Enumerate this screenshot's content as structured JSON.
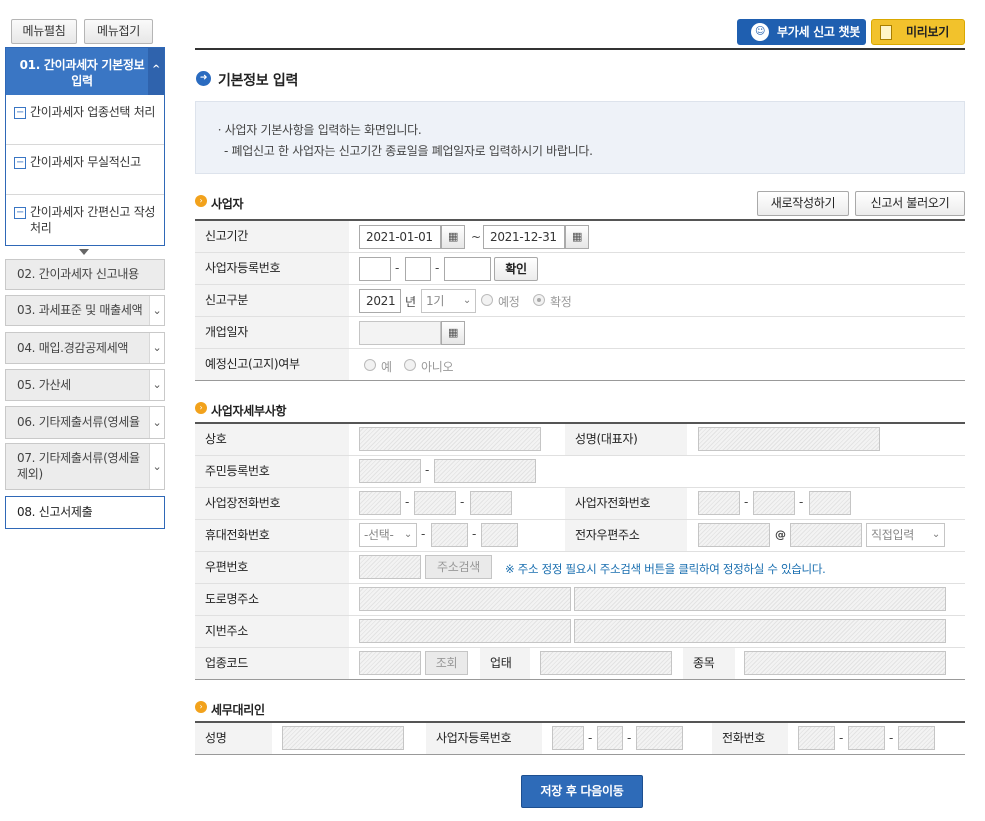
{
  "toolbar": {
    "expand": "메뉴펼침",
    "collapse": "메뉴접기",
    "chatbot": "부가세 신고 챗봇",
    "preview": "미리보기"
  },
  "sidebar": {
    "active": {
      "label": "01. 간이과세자 기본정보 입력",
      "subs": [
        "간이과세자 업종선택 처리",
        "간이과세자 무실적신고",
        "간이과세자 간편신고 작성 처리"
      ]
    },
    "items": [
      "02. 간이과세자 신고내용",
      "03. 과세표준 및 매출세액",
      "04. 매입.경감공제세액",
      "05. 가산세",
      "06. 기타제출서류(영세율",
      "07. 기타제출서류(영세율 제외)",
      "08. 신고서제출"
    ]
  },
  "page": {
    "title": "기본정보 입력",
    "info1": "ㆍ사업자 기본사항을 입력하는 화면입니다.",
    "info2": "- 폐업신고 한 사업자는 신고기간 종료일을 폐업일자로 입력하시기 바랍니다."
  },
  "business": {
    "title": "사업자",
    "new_btn": "새로작성하기",
    "load_btn": "신고서 불러오기",
    "period_label": "신고기간",
    "period_from": "2021-01-01",
    "tilde": "~",
    "period_to": "2021-12-31",
    "regno_label": "사업자등록번호",
    "confirm_btn": "확인",
    "dash": "-",
    "type_label": "신고구분",
    "year": "2021",
    "year_unit": "년",
    "term": "1기",
    "prelim": "예정",
    "final": "확정",
    "open_label": "개업일자",
    "notice_label": "예정신고(고지)여부",
    "yes": "예",
    "no": "아니오"
  },
  "detail": {
    "title": "사업자세부사항",
    "trade": "상호",
    "ceo": "성명(대표자)",
    "resident": "주민등록번호",
    "biz_phone": "사업장전화번호",
    "owner_phone": "사업자전화번호",
    "mobile": "휴대전화번호",
    "mobile_sel": "-선택-",
    "email": "전자우편주소",
    "at": "@",
    "email_sel": "직접입력",
    "zip": "우편번호",
    "addr_btn": "주소검색",
    "addr_note": "※ 주소 정정 필요시 주소검색 버튼을 클릭하여 정정하실 수 있습니다.",
    "road": "도로명주소",
    "lot": "지번주소",
    "code": "업종코드",
    "lookup": "조회",
    "biztype": "업태",
    "item": "종목"
  },
  "agent": {
    "title": "세무대리인",
    "name": "성명",
    "regno": "사업자등록번호",
    "phone": "전화번호"
  },
  "save_btn": "저장 후 다음이동"
}
